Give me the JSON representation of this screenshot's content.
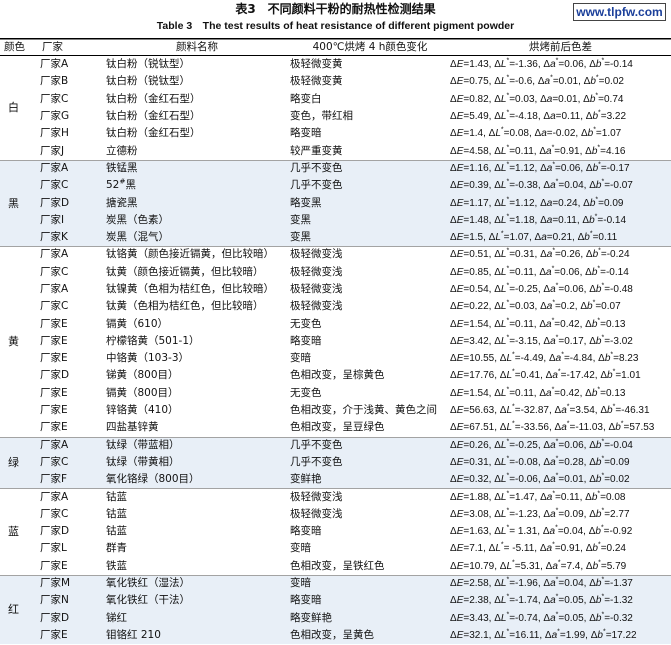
{
  "caption": {
    "cn": "表3　不同颜料干粉的耐热性检测结果",
    "en": "Table 3　The test results of heat resistance of different pigment powder"
  },
  "watermark": "www.tlpfw.com",
  "colors": {
    "band": "#e8eff7",
    "watermark_text": "#1b3f9a"
  },
  "table": {
    "headers": [
      "颜色",
      "厂家",
      "颜料名称",
      "400℃烘烤 4 h颜色变化",
      "烘烤前后色差"
    ],
    "groups": [
      {
        "color": "白",
        "rows": [
          {
            "maker": "厂家A",
            "pigment": "钛白粉（锐钛型）",
            "change": "极轻微变黄",
            "diff": "ΔE=1.43, ΔL*=-1.36, Δa*=0.06, Δb*=-0.14"
          },
          {
            "maker": "厂家B",
            "pigment": "钛白粉（锐钛型）",
            "change": "极轻微变黄",
            "diff": "ΔE=0.75, ΔL*=-0.6, Δa*=0.01, Δb*=0.02"
          },
          {
            "maker": "厂家C",
            "pigment": "钛白粉（金红石型）",
            "change": "略变白",
            "diff": "ΔE=0.82, ΔL*=0.03, Δa=0.01, Δb*=0.74"
          },
          {
            "maker": "厂家G",
            "pigment": "钛白粉（金红石型）",
            "change": "变色，带红相",
            "diff": "ΔE=5.49, ΔL*=-4.18, Δa=0.11, Δb*=3.22"
          },
          {
            "maker": "厂家H",
            "pigment": "钛白粉（金红石型）",
            "change": "略变暗",
            "diff": "ΔE=1.4, ΔL*=0.08, Δa=-0.02, Δb*=1.07"
          },
          {
            "maker": "厂家J",
            "pigment": "立德粉",
            "change": "较严重变黄",
            "diff": "ΔE=4.58, ΔL*=0.11, Δa*=0.91, Δb*=4.16"
          }
        ]
      },
      {
        "color": "黑",
        "rows": [
          {
            "maker": "厂家A",
            "pigment": "铁锰黑",
            "change": "几乎不变色",
            "diff": "ΔE=1.16, ΔL*=1.12, Δa*=0.06, Δb*=-0.17"
          },
          {
            "maker": "厂家C",
            "pigment": "52#黑",
            "change": "几乎不变色",
            "diff": "ΔE=0.39, ΔL*=-0.38, Δa*=0.04, Δb*=-0.07"
          },
          {
            "maker": "厂家D",
            "pigment": "搪瓷黑",
            "change": "略变黑",
            "diff": "ΔE=1.17, ΔL*=1.12, Δa=0.24, Δb*=0.09"
          },
          {
            "maker": "厂家I",
            "pigment": "炭黑（色素）",
            "change": "变黑",
            "diff": "ΔE=1.48, ΔL*=1.18, Δa=0.11, Δb*=-0.14"
          },
          {
            "maker": "厂家K",
            "pigment": "炭黑（混气）",
            "change": "变黑",
            "diff": "ΔE=1.5, ΔL*=1.07, Δa=0.21, Δb*=0.11"
          }
        ]
      },
      {
        "color": "黄",
        "rows": [
          {
            "maker": "厂家A",
            "pigment": "钛铬黄（颜色接近镉黄，但比较暗）",
            "change": "极轻微变浅",
            "diff": "ΔE=0.51, ΔL*=0.31, Δa*=0.26, Δb*=-0.24"
          },
          {
            "maker": "厂家C",
            "pigment": "钛黄（颜色接近镉黄，但比较暗）",
            "change": "极轻微变浅",
            "diff": "ΔE=0.85, ΔL*=0.11, Δa*=0.06, Δb*=-0.14"
          },
          {
            "maker": "厂家A",
            "pigment": "钛镍黄（色相为桔红色，但比较暗）",
            "change": "极轻微变浅",
            "diff": "ΔE=0.54, ΔL*=-0.25, Δa*=0.06, Δb*=-0.48"
          },
          {
            "maker": "厂家C",
            "pigment": "钛黄（色相为桔红色，但比较暗）",
            "change": "极轻微变浅",
            "diff": "ΔE=0.22, ΔL*=0.03, Δa*=0.2, Δb*=0.07"
          },
          {
            "maker": "厂家E",
            "pigment": "镉黄（610）",
            "change": "无变色",
            "diff": "ΔE=1.54, ΔL*=0.11, Δa*=0.42, Δb*=0.13"
          },
          {
            "maker": "厂家E",
            "pigment": "柠檬铬黄（501-1）",
            "change": "略变暗",
            "diff": "ΔE=3.42, ΔL*=-3.15, Δa*=0.17, Δb*=-3.02"
          },
          {
            "maker": "厂家E",
            "pigment": "中铬黄（103-3）",
            "change": "变暗",
            "diff": "ΔE=10.55, ΔL*=-4.49, Δa*=-4.84, Δb*=8.23"
          },
          {
            "maker": "厂家D",
            "pigment": "锑黄（800目）",
            "change": "色相改变，呈棕黄色",
            "diff": "ΔE=17.76, ΔL*=0.41, Δa*=-17.42, Δb*=1.01"
          },
          {
            "maker": "厂家E",
            "pigment": "镉黄（800目）",
            "change": "无变色",
            "diff": "ΔE=1.54, ΔL*=0.11, Δa*=0.42, Δb*=0.13"
          },
          {
            "maker": "厂家E",
            "pigment": "锌铬黄（410）",
            "change": "色相改变，介于浅黄、黄色之间",
            "diff": "ΔE=56.63, ΔL*=-32.87, Δa*=3.54, Δb*=-46.31"
          },
          {
            "maker": "厂家E",
            "pigment": "四盐基锌黄",
            "change": "色相改变，呈豆绿色",
            "diff": "ΔE=67.51, ΔL*=-33.56, Δa*=-11.03, Δb*=57.53"
          }
        ]
      },
      {
        "color": "绿",
        "rows": [
          {
            "maker": "厂家A",
            "pigment": "钛绿（带蓝相）",
            "change": "几乎不变色",
            "diff": "ΔE=0.26, ΔL*=-0.25, Δa*=0.06, Δb*=-0.04"
          },
          {
            "maker": "厂家C",
            "pigment": "钛绿（带黄相）",
            "change": "几乎不变色",
            "diff": "ΔE=0.31, ΔL*=-0.08, Δa*=0.28, Δb*=0.09"
          },
          {
            "maker": "厂家F",
            "pigment": "氧化铬绿（800目）",
            "change": "变鲜艳",
            "diff": "ΔE=0.32, ΔL*=-0.06, Δa*=0.01, Δb*=0.02"
          }
        ]
      },
      {
        "color": "蓝",
        "rows": [
          {
            "maker": "厂家A",
            "pigment": "钴蓝",
            "change": "极轻微变浅",
            "diff": "ΔE=1.88, ΔL*=1.47, Δa*=0.11, Δb*=0.08"
          },
          {
            "maker": "厂家C",
            "pigment": "钴蓝",
            "change": "极轻微变浅",
            "diff": "ΔE=3.08, ΔL*=-1.23, Δa*=0.09, Δb*=2.77"
          },
          {
            "maker": "厂家D",
            "pigment": "钴蓝",
            "change": "略变暗",
            "diff": "ΔE=1.63, ΔL*= 1.31, Δa*=0.04, Δb*=-0.92"
          },
          {
            "maker": "厂家L",
            "pigment": "群青",
            "change": "变暗",
            "diff": "ΔE=7.1, ΔL*= -5.11, Δa*=0.91, Δb*=0.24"
          },
          {
            "maker": "厂家E",
            "pigment": "铁蓝",
            "change": "色相改变，呈铁红色",
            "diff": "ΔE=10.79, ΔL*=5.31, Δa*=7.4, Δb*=5.79"
          }
        ]
      },
      {
        "color": "红",
        "rows": [
          {
            "maker": "厂家M",
            "pigment": "氧化铁红（湿法）",
            "change": "变暗",
            "diff": "ΔE=2.58, ΔL*=-1.96, Δa*=0.04, Δb*=-1.37"
          },
          {
            "maker": "厂家N",
            "pigment": "氧化铁红（干法）",
            "change": "略变暗",
            "diff": "ΔE=2.38, ΔL*=-1.74, Δa*=0.05, Δb*=-1.32"
          },
          {
            "maker": "厂家D",
            "pigment": "锑红",
            "change": "略变鲜艳",
            "diff": "ΔE=3.43, ΔL*=-0.74, Δa*=0.05, Δb*=-0.32"
          },
          {
            "maker": "厂家E",
            "pigment": "钼铬红 210",
            "change": "色相改变，呈黄色",
            "diff": "ΔE=32.1, ΔL*=16.11, Δa*=1.99, Δb*=17.22"
          }
        ]
      }
    ]
  }
}
